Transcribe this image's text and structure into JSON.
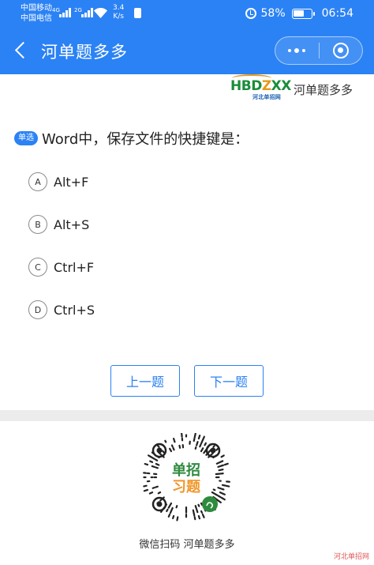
{
  "status_bar": {
    "carrier_1": "中国移动",
    "carrier_2": "中国电信",
    "net_1": "4G",
    "net_2": "2G",
    "speed_value": "3.4",
    "speed_unit": "K/s",
    "battery": "58%",
    "time": "06:54"
  },
  "title_bar": {
    "title": "河单题多多",
    "back_icon": "chevron-left-icon",
    "menu_icon": "more-dots-icon",
    "close_icon": "close-ring-icon"
  },
  "brand": {
    "logo_letters": "HBDZXX",
    "logo_subtext": "河北单招网",
    "name": "河单题多多"
  },
  "question": {
    "type_badge": "单选",
    "text": "Word中，保存文件的快捷键是："
  },
  "options": [
    {
      "letter": "A",
      "text": "Alt+F"
    },
    {
      "letter": "B",
      "text": "Alt+S"
    },
    {
      "letter": "C",
      "text": "Ctrl+F"
    },
    {
      "letter": "D",
      "text": "Ctrl+S"
    }
  ],
  "nav": {
    "prev_label": "上一题",
    "next_label": "下一题"
  },
  "qr": {
    "line_1": "单招",
    "line_2": "习题",
    "caption": "微信扫码 河单题多多"
  },
  "watermark": "河北单招网",
  "colors": {
    "primary": "#2b82f4",
    "logo_green": "#1a8c3a",
    "logo_orange": "#e59a1a",
    "qr_green": "#2e8b3e",
    "qr_orange": "#f0962a",
    "watermark_red": "#e05656"
  }
}
